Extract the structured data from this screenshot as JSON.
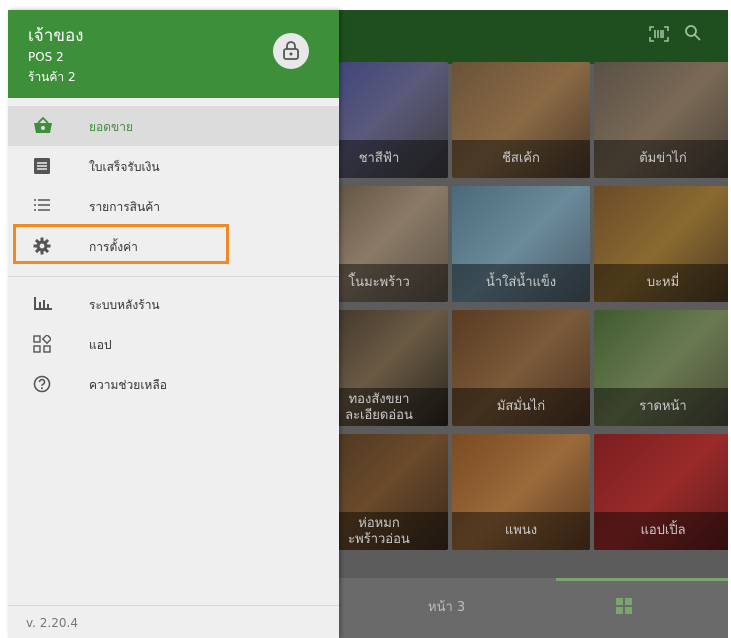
{
  "header": {
    "owner": "เจ้าของ",
    "pos": "POS 2",
    "shop": "ร้านค้า 2"
  },
  "menu": {
    "items": [
      {
        "label": "ยอดขาย",
        "icon": "basket-icon",
        "active": true
      },
      {
        "label": "ใบเสร็จรับเงิน",
        "icon": "receipt-icon"
      },
      {
        "label": "รายการสินค้า",
        "icon": "list-icon"
      },
      {
        "label": "การตั้งค่า",
        "icon": "gear-icon"
      },
      {
        "label": "ระบบหลังร้าน",
        "icon": "bar-chart-icon"
      },
      {
        "label": "แอป",
        "icon": "apps-icon"
      },
      {
        "label": "ความช่วยเหลือ",
        "icon": "help-icon"
      }
    ]
  },
  "version": "v. 2.20.4",
  "products": [
    {
      "name": "ชาสีฟ้า"
    },
    {
      "name": "ชีสเค้ก"
    },
    {
      "name": "ต้มข่าไก่"
    },
    {
      "name": "โ้นมะพร้าว"
    },
    {
      "name": "น้ำใส่น้ำแข็ง"
    },
    {
      "name": "บะหมี่"
    },
    {
      "name": "ทองสังขยา",
      "sub": "ละเอียดอ่อน"
    },
    {
      "name": "มัสมั่นไก่"
    },
    {
      "name": "ราดหน้า"
    },
    {
      "name": "ห่อหมก",
      "sub": "ะพร้าวอ่อน"
    },
    {
      "name": "แพนง"
    },
    {
      "name": "แอปเปิ้ล"
    }
  ],
  "footer": {
    "page_label": "หน้า 3"
  },
  "colors": {
    "header_green": "#3e8f3a",
    "highlight_orange": "#f08a24",
    "accent_green": "#7aa56f"
  }
}
